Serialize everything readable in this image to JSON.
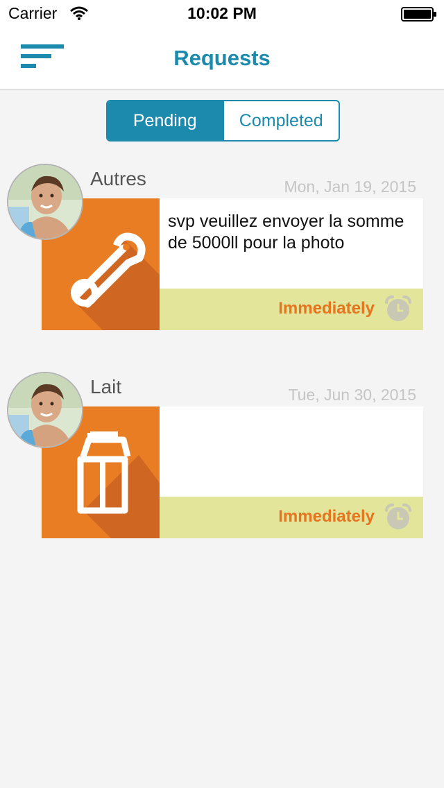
{
  "status_bar": {
    "carrier": "Carrier",
    "time": "10:02 PM"
  },
  "nav": {
    "title": "Requests"
  },
  "tabs": [
    {
      "label": "Pending",
      "active": true
    },
    {
      "label": "Completed",
      "active": false
    }
  ],
  "requests": [
    {
      "category": "Autres",
      "date": "Mon, Jan 19, 2015",
      "message": "svp veuillez envoyer la somme de 5000ll pour la photo",
      "urgency": "Immediately",
      "icon": "safety-pin-icon"
    },
    {
      "category": "Lait",
      "date": "Tue, Jun 30, 2015",
      "message": "",
      "urgency": "Immediately",
      "icon": "milk-carton-icon"
    }
  ],
  "colors": {
    "accent": "#1b8aad",
    "tile": "#e87d24",
    "urgency_bg": "#e2e59a",
    "urgency_text": "#e5751f"
  }
}
